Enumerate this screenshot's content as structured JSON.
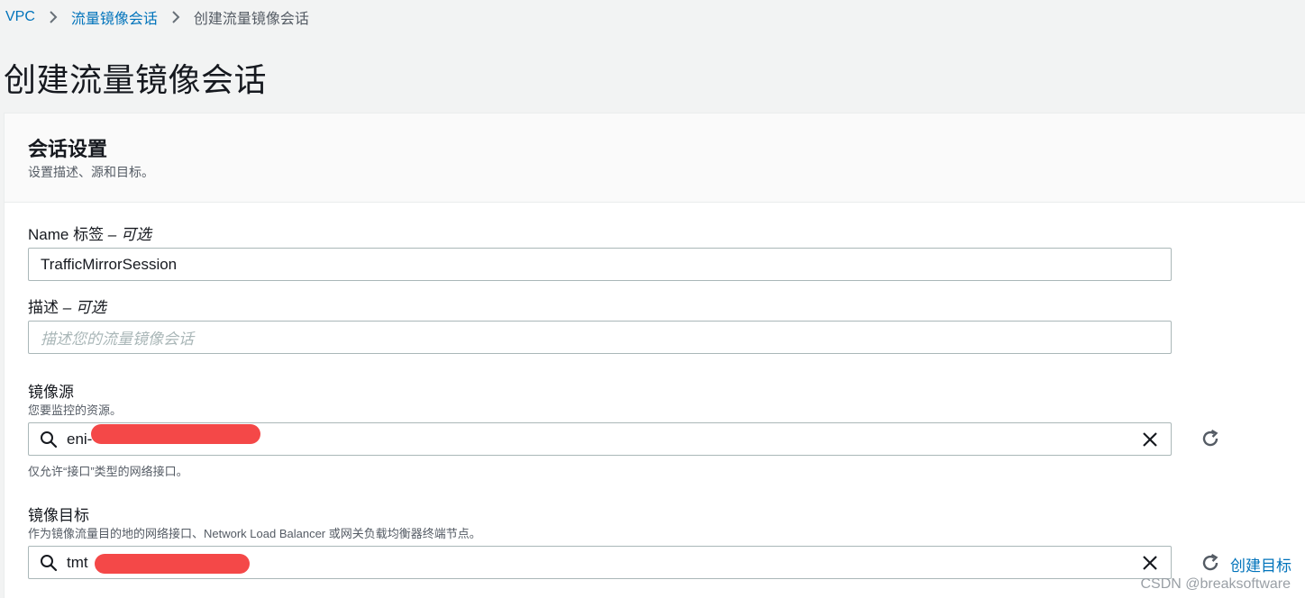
{
  "breadcrumb": {
    "items": [
      {
        "label": "VPC"
      },
      {
        "label": "流量镜像会话"
      },
      {
        "label": "创建流量镜像会话"
      }
    ]
  },
  "page": {
    "title": "创建流量镜像会话"
  },
  "panel": {
    "title": "会话设置",
    "description": "设置描述、源和目标。"
  },
  "fields": {
    "name": {
      "label": "Name 标签",
      "optional": " – 可选",
      "value": "TrafficMirrorSession"
    },
    "description": {
      "label": "描述",
      "optional": " – 可选",
      "placeholder": "描述您的流量镜像会话"
    },
    "source": {
      "label": "镜像源",
      "description": "您要监控的资源。",
      "value": "eni-",
      "hint": "仅允许“接口”类型的网络接口。"
    },
    "target": {
      "label": "镜像目标",
      "description": "作为镜像流量目的地的网络接口、Network Load Balancer 或网关负载均衡器终端节点。",
      "value": "tmt",
      "create_link": "创建目标"
    }
  },
  "watermark": "CSDN @breaksoftware",
  "colors": {
    "link": "#0073bb",
    "redaction": "#f44848",
    "background": "#f2f3f3"
  }
}
